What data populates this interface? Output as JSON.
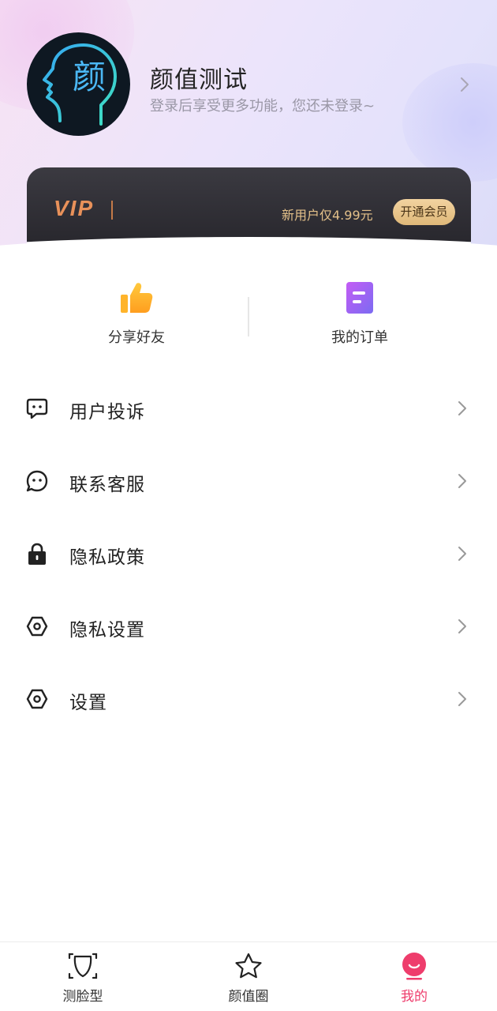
{
  "header": {
    "avatar_char": "颜",
    "title": "颜值测试",
    "subtitle": "登录后享受更多功能，您还未登录~"
  },
  "vip": {
    "logo": "VIP",
    "promo": "新用户仅4.99元",
    "button": "开通会员"
  },
  "quick_actions": [
    {
      "label": "分享好友",
      "icon": "thumbs-up-icon"
    },
    {
      "label": "我的订单",
      "icon": "order-icon"
    }
  ],
  "menu": {
    "items": [
      {
        "label": "用户投诉",
        "icon": "chat-bubble-icon"
      },
      {
        "label": "联系客服",
        "icon": "customer-service-icon"
      },
      {
        "label": "隐私政策",
        "icon": "lock-icon"
      },
      {
        "label": "隐私设置",
        "icon": "hex-settings-icon"
      },
      {
        "label": "设置",
        "icon": "hex-settings-icon"
      }
    ]
  },
  "tabbar": {
    "items": [
      {
        "label": "测脸型",
        "icon": "face-scan-icon"
      },
      {
        "label": "颜值圈",
        "icon": "star-icon"
      },
      {
        "label": "我的",
        "icon": "smile-profile-icon",
        "active": true
      }
    ]
  },
  "colors": {
    "accent": "#ee3d6c",
    "vip_gold": "#e3c089",
    "vip_logo": "#e8915a"
  }
}
